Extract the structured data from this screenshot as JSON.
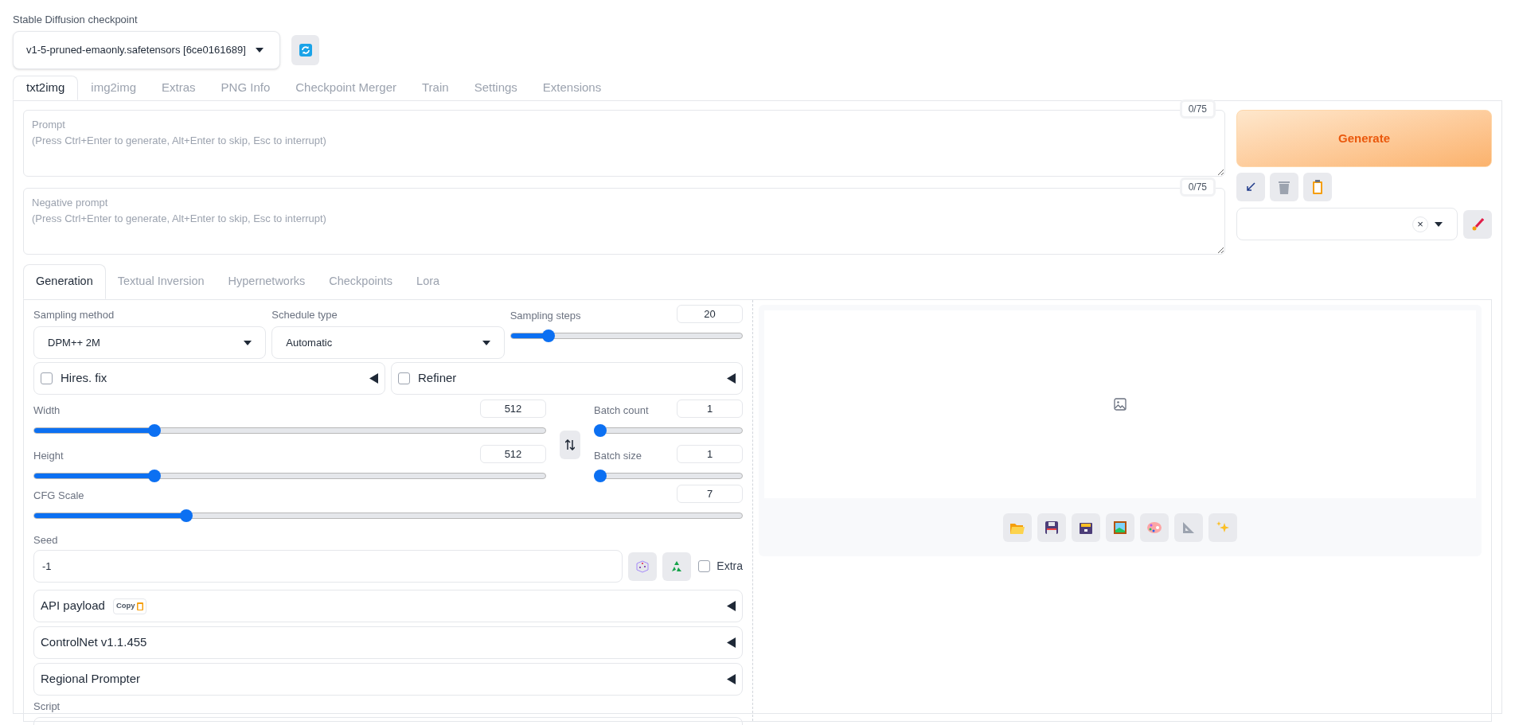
{
  "checkpoint": {
    "label": "Stable Diffusion checkpoint",
    "value": "v1-5-pruned-emaonly.safetensors [6ce0161689]"
  },
  "main_tabs": [
    {
      "label": "txt2img",
      "selected": true
    },
    {
      "label": "img2img",
      "selected": false
    },
    {
      "label": "Extras",
      "selected": false
    },
    {
      "label": "PNG Info",
      "selected": false
    },
    {
      "label": "Checkpoint Merger",
      "selected": false
    },
    {
      "label": "Train",
      "selected": false
    },
    {
      "label": "Settings",
      "selected": false
    },
    {
      "label": "Extensions",
      "selected": false
    }
  ],
  "prompts": [
    {
      "placeholder": "Prompt\n(Press Ctrl+Enter to generate, Alt+Enter to skip, Esc to interrupt)",
      "counter": "0/75"
    },
    {
      "placeholder": "Negative prompt\n(Press Ctrl+Enter to generate, Alt+Enter to skip, Esc to interrupt)",
      "counter": "0/75"
    }
  ],
  "generate_button": "Generate",
  "styles_clear": "×",
  "sub_tabs": [
    {
      "label": "Generation",
      "selected": true
    },
    {
      "label": "Textual Inversion",
      "selected": false
    },
    {
      "label": "Hypernetworks",
      "selected": false
    },
    {
      "label": "Checkpoints",
      "selected": false
    },
    {
      "label": "Lora",
      "selected": false
    }
  ],
  "sampling_method": {
    "label": "Sampling method",
    "value": "DPM++ 2M"
  },
  "schedule_type": {
    "label": "Schedule type",
    "value": "Automatic"
  },
  "sampling_steps": {
    "label": "Sampling steps",
    "value": "20",
    "level": 0.145
  },
  "toggles": [
    {
      "label": "Hires. fix",
      "checked": false
    },
    {
      "label": "Refiner",
      "checked": false
    }
  ],
  "width": {
    "label": "Width",
    "value": "512",
    "level": 0.23
  },
  "height": {
    "label": "Height",
    "value": "512",
    "level": 0.23
  },
  "batch_count": {
    "label": "Batch count",
    "value": "1",
    "level": 0
  },
  "batch_size": {
    "label": "Batch size",
    "value": "1",
    "level": 0
  },
  "cfg_scale": {
    "label": "CFG Scale",
    "value": "7",
    "level": 0.21
  },
  "seed": {
    "label": "Seed",
    "value": "-1",
    "extra": {
      "label": "Extra",
      "checked": false
    }
  },
  "accordions": [
    {
      "label": "API payload",
      "badge": "Copy"
    },
    {
      "label": "ControlNet v1.1.455"
    },
    {
      "label": "Regional Prompter"
    }
  ],
  "script": {
    "label": "Script"
  }
}
